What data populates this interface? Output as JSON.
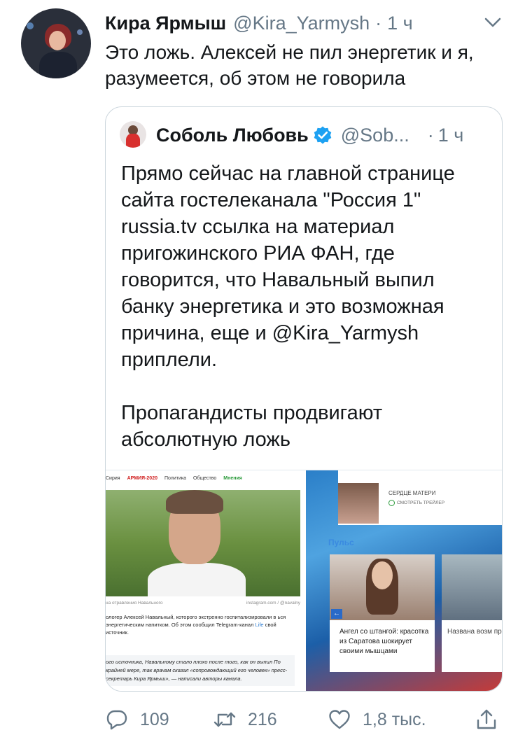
{
  "tweet": {
    "author_name": "Кира Ярмыш",
    "author_handle": "@Kira_Yarmysh",
    "time": "1 ч",
    "text": "Это ложь. Алексей не пил энергетик и я, разумеется, об этом не говорила"
  },
  "quoted": {
    "author_name": "Соболь Любовь",
    "author_handle": "@Sob...",
    "time": "1 ч",
    "paragraph1": "Прямо сейчас на главной странице сайта гостелеканала \"Россия 1\" russia.tv ссылка на материал пригожинского РИА ФАН, где говорится, что Навальный выпил банку энергетика и это возможная причина, еще и @Kira_Yarmysh приплели.",
    "paragraph2": "Пропагандисты продвигают абсолютную ложь"
  },
  "media_left": {
    "nav": [
      "Сирия",
      "АРМИЯ-2020",
      "Политика",
      "Общество",
      "Мнения"
    ],
    "caption_left": "на отравления Навального",
    "caption_right": "instagram.com / @navalny",
    "para_text": "ологер Алексей Навальный, которого экстренно госпитализировали в ься энергетическим напитком. Об этом сообщил Telegram-канал",
    "para_link": "Life",
    "para_end": "свой источник.",
    "quote_text": "ого источника, Навальному стало плохо после того, как он выпил По крайней мере, так врачам сказал «сопровождающий его человек» пресс-секретарь Кира Ярмыш», — написали авторы канала."
  },
  "media_right": {
    "promo_title": "СЕРДЦЕ МАТЕРИ",
    "promo_action": "СМОТРЕТЬ ТРЕЙЛЕР",
    "section": "Пульс",
    "card1_text": "Ангел со штангой: красотка из Саратова шокирует своими мышцами",
    "card2_text": "Названа возм причина отрав Навального"
  },
  "actions": {
    "reply_count": "109",
    "retweet_count": "216",
    "like_count": "1,8 тыс."
  },
  "colors": {
    "verified": "#1da1f2",
    "secondary_text": "#657786",
    "border": "#ccd6dd"
  }
}
